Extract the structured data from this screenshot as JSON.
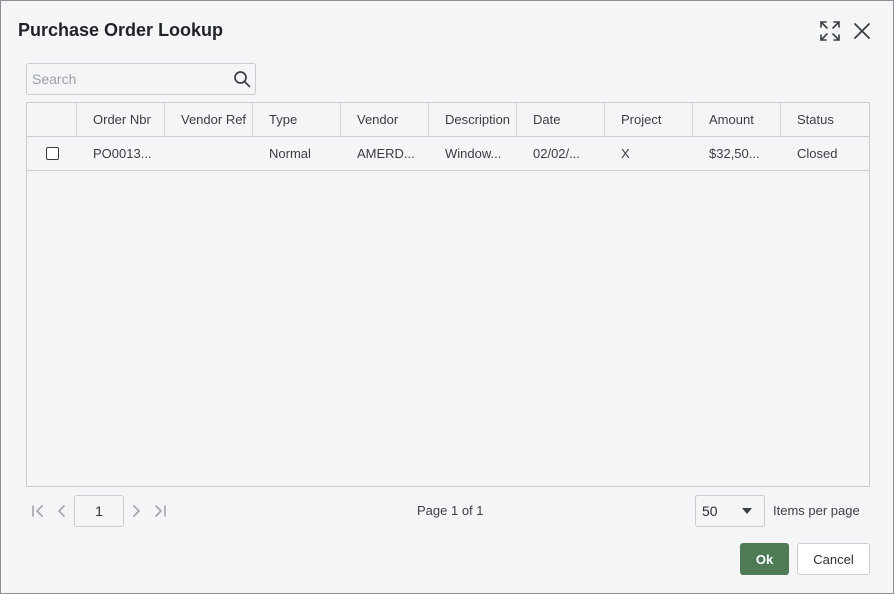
{
  "dialog": {
    "title": "Purchase Order Lookup",
    "icons": {
      "expand": "expand-icon",
      "close": "close-icon"
    }
  },
  "search": {
    "placeholder": "Search",
    "value": "",
    "icon": "search-icon"
  },
  "grid": {
    "columns": [
      "Order Nbr",
      "Vendor Ref",
      "Type",
      "Vendor",
      "Description",
      "Date",
      "Project",
      "Amount",
      "Status"
    ],
    "rows": [
      {
        "checked": false,
        "cells": [
          "PO0013...",
          "",
          "Normal",
          "AMERD...",
          "Window...",
          "02/02/...",
          "X",
          "$32,50...",
          "Closed"
        ]
      }
    ]
  },
  "pager": {
    "current_page": "1",
    "page_info": "Page 1 of 1",
    "items_per_page": "50",
    "items_per_page_label": "Items per page"
  },
  "buttons": {
    "ok": "Ok",
    "cancel": "Cancel"
  },
  "colors": {
    "primary": "#4f7a56",
    "background": "#f4f5f7",
    "border": "#c9ccd1"
  }
}
